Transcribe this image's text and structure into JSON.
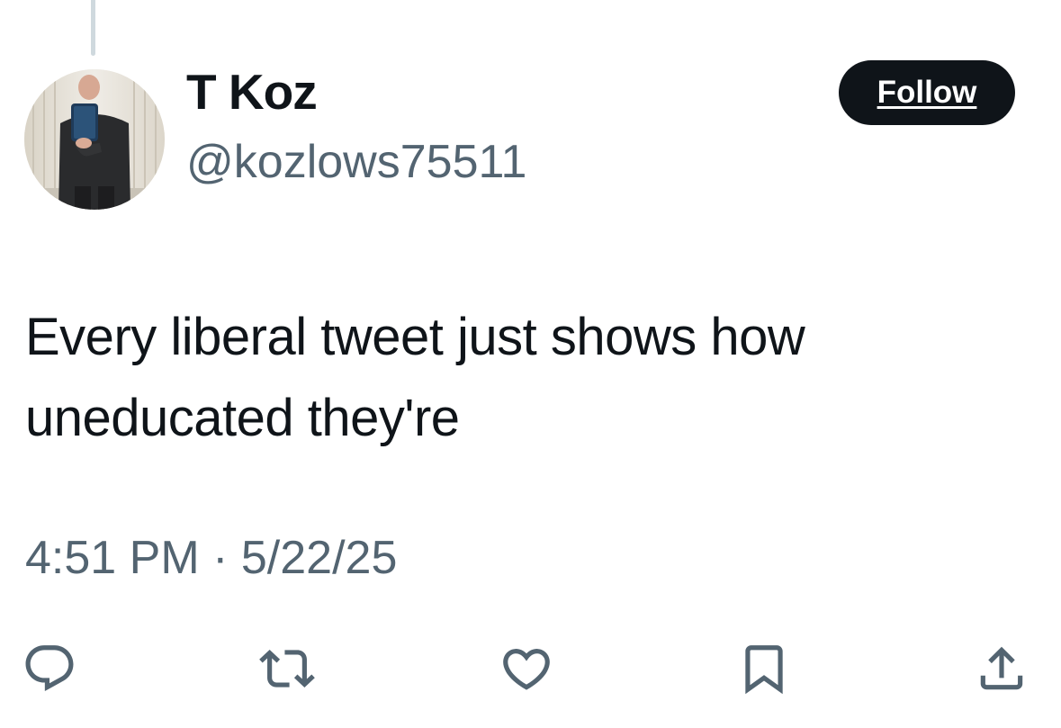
{
  "author": {
    "display_name": "T Koz",
    "handle": "@kozlows75511"
  },
  "follow_label": "Follow",
  "tweet": {
    "text": "Every liberal tweet just shows how uneducated they're",
    "time": "4:51 PM",
    "separator": "·",
    "date": "5/22/25"
  },
  "actions": [
    {
      "icon": "reply-icon"
    },
    {
      "icon": "retweet-icon"
    },
    {
      "icon": "like-icon"
    },
    {
      "icon": "bookmark-icon"
    },
    {
      "icon": "share-icon"
    }
  ],
  "colors": {
    "text_primary": "#0f1419",
    "text_secondary": "#536471",
    "follow_bg": "#0f1419",
    "follow_text": "#ffffff",
    "thread_line": "#cfd9de"
  }
}
